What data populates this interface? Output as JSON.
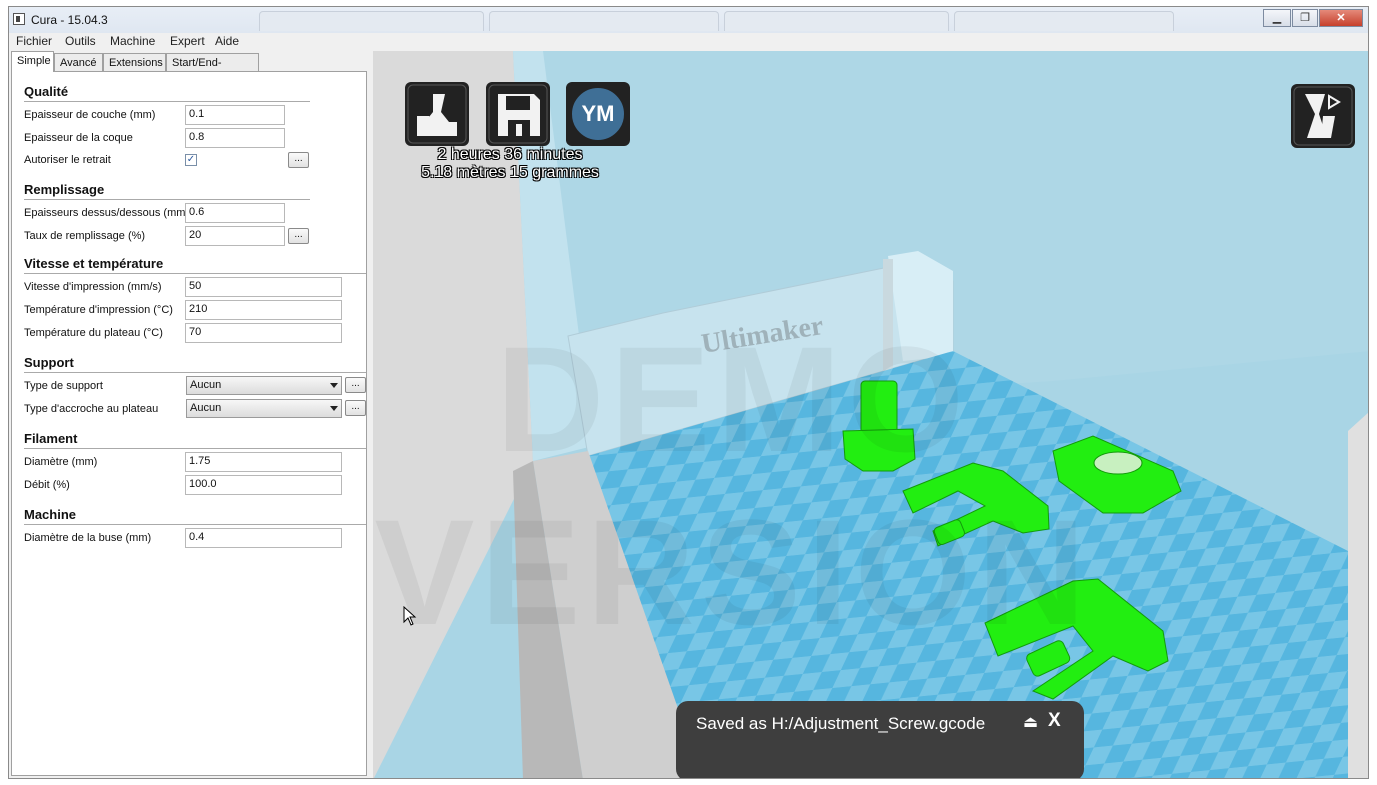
{
  "window": {
    "title": "Cura - 15.04.3"
  },
  "menu": [
    "Fichier",
    "Outils",
    "Machine",
    "Expert",
    "Aide"
  ],
  "tabs": [
    "Simple",
    "Avancé",
    "Extensions",
    "Start/End-GCode"
  ],
  "sections": {
    "quality": {
      "title": "Qualité",
      "layer_height": {
        "label": "Epaisseur de couche (mm)",
        "value": "0.1"
      },
      "shell_thickness": {
        "label": "Epaisseur de la coque",
        "value": "0.8"
      },
      "retraction": {
        "label": "Autoriser le retrait",
        "checked": true
      }
    },
    "fill": {
      "title": "Remplissage",
      "bottom_top": {
        "label": "Epaisseurs dessus/dessous (mm)",
        "value": "0.6"
      },
      "density": {
        "label": "Taux de remplissage (%)",
        "value": "20"
      }
    },
    "speed": {
      "title": "Vitesse et température",
      "print_speed": {
        "label": "Vitesse d'impression (mm/s)",
        "value": "50"
      },
      "print_temp": {
        "label": "Température d'impression (°C)",
        "value": "210"
      },
      "bed_temp": {
        "label": "Température du plateau (°C)",
        "value": "70"
      }
    },
    "support": {
      "title": "Support",
      "support_type": {
        "label": "Type de support",
        "value": "Aucun"
      },
      "adhesion_type": {
        "label": "Type d'accroche au plateau",
        "value": "Aucun"
      }
    },
    "filament": {
      "title": "Filament",
      "diameter": {
        "label": "Diamètre (mm)",
        "value": "1.75"
      },
      "flow": {
        "label": "Débit (%)",
        "value": "100.0"
      }
    },
    "machine": {
      "title": "Machine",
      "nozzle": {
        "label": "Diamètre de la buse (mm)",
        "value": "0.4"
      }
    }
  },
  "more_label": "...",
  "viewer": {
    "print_time": "2 heures 36 minutes",
    "print_material": "5.18 mètres 15 grammes",
    "ym_label": "YM",
    "brand_text": "Ultimaker",
    "watermark": "DEMO VERSION",
    "toast_text": "Saved as H:/Adjustment_Screw.gcode",
    "toast_eject": "⏏",
    "toast_close": "X"
  },
  "colors": {
    "model": "#22ee11",
    "wall": "#a6d3e3",
    "floor": "#78c6e6",
    "floor_check": "#56b6df",
    "toast": "#3e3e3e"
  }
}
